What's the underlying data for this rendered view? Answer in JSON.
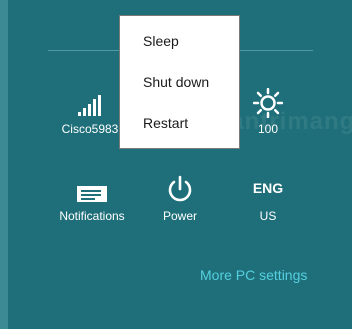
{
  "quick_settings": {
    "network": {
      "label": "Cisco5983",
      "icon": "wifi-signal-icon"
    },
    "brightness": {
      "label": "100",
      "icon": "brightness-sun-icon"
    },
    "notifications": {
      "label": "Notifications",
      "icon": "notifications-icon"
    },
    "power": {
      "label": "Power",
      "icon": "power-icon"
    },
    "keyboard": {
      "code": "ENG",
      "label": "US"
    }
  },
  "power_menu": {
    "items": [
      "Sleep",
      "Shut down",
      "Restart"
    ]
  },
  "more_settings": "More PC settings",
  "watermark": "Quantrimang",
  "colors": {
    "background": "#1e6f79",
    "link": "#55cfe0",
    "menu_background": "#ffffff"
  }
}
